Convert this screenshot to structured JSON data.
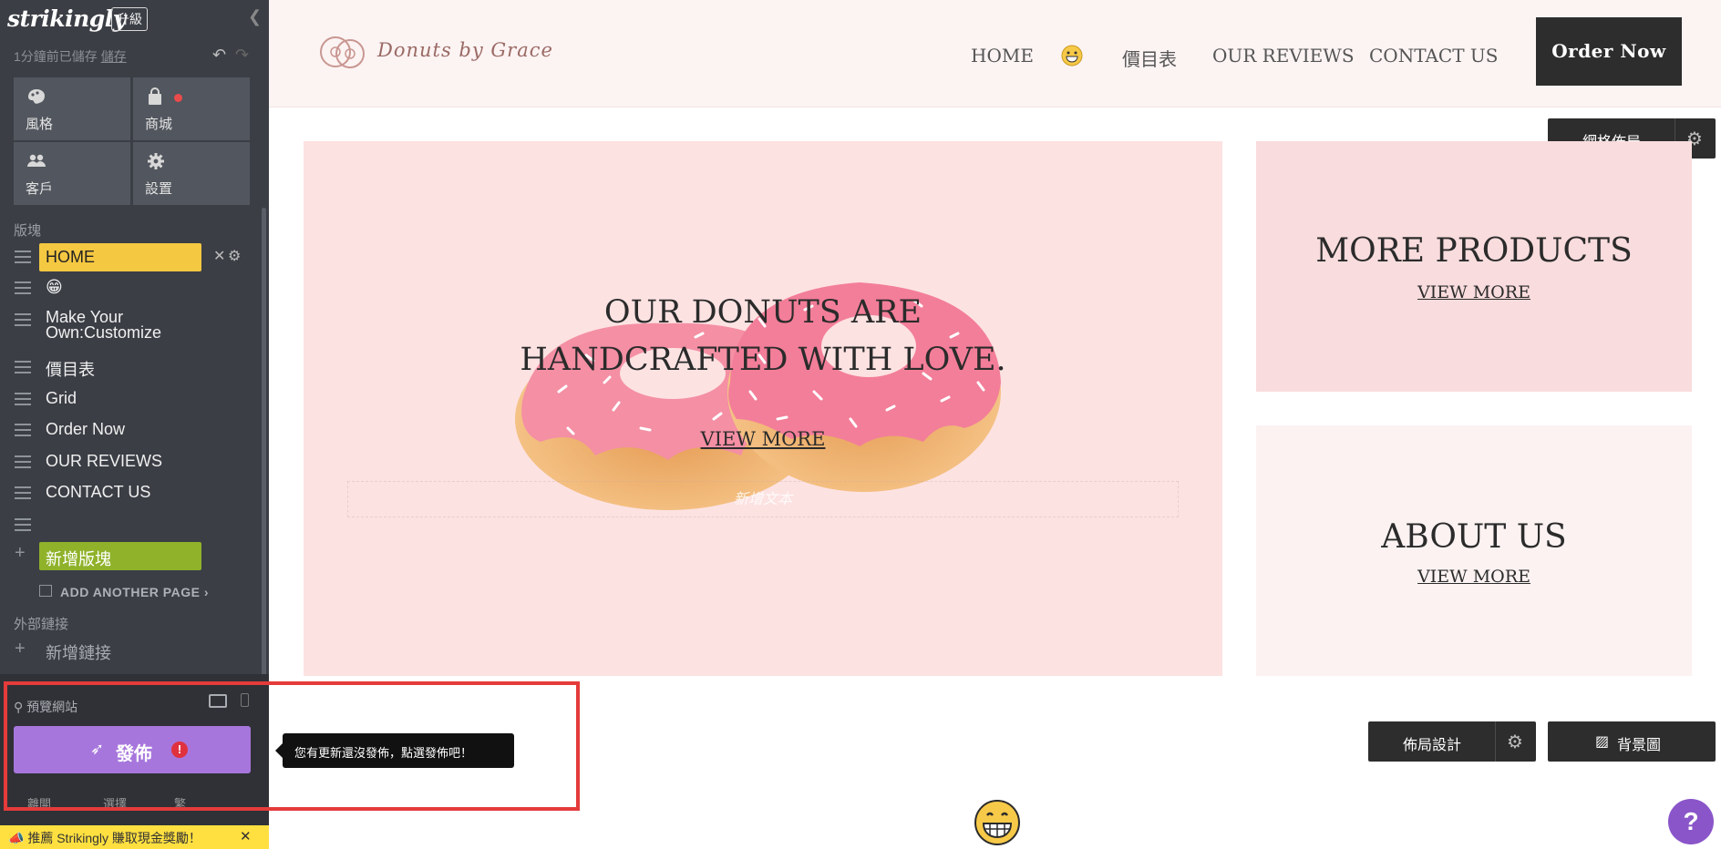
{
  "sidebar": {
    "logo": "strikingly",
    "upgrade_label": "升級",
    "saved_text": "1分鐘前已儲存",
    "save_link": "儲存",
    "tiles": [
      {
        "label": "風格",
        "icon": "palette-icon"
      },
      {
        "label": "商城",
        "icon": "shopping-bag-icon"
      },
      {
        "label": "客戶",
        "icon": "users-icon"
      },
      {
        "label": "設置",
        "icon": "gear-icon"
      }
    ],
    "sections_label": "版塊",
    "sections": [
      {
        "label": "HOME"
      },
      {
        "label": "😁"
      },
      {
        "label": "Make Your Own:Customize"
      },
      {
        "label": "價目表"
      },
      {
        "label": "Grid"
      },
      {
        "label": "Order Now"
      },
      {
        "label": "OUR REVIEWS"
      },
      {
        "label": "CONTACT US"
      },
      {
        "label": ""
      }
    ],
    "add_section": "新增版塊",
    "add_page": "ADD ANOTHER PAGE ›",
    "external_label": "外部鏈接",
    "add_external": "新增鏈接",
    "preview": "預覽網站",
    "publish": "發佈",
    "publish_warning": "!",
    "mini_tabs": [
      "離開",
      "選擇",
      "繁"
    ],
    "referral": "推薦 Strikingly 賺取現金獎勵！",
    "tooltip": "您有更新還沒發佈，點選發佈吧！"
  },
  "site": {
    "brand": "Donuts by Grace",
    "nav": [
      "HOME",
      "價目表",
      "OUR REVIEWS",
      "CONTACT US"
    ],
    "order_button": "Order Now",
    "grid_layout_button": "網格佈局",
    "hero": {
      "title_line1": "OUR DONUTS ARE",
      "title_line2": "HANDCRAFTED WITH LOVE.",
      "link": "VIEW MORE",
      "placeholder": "新增文本"
    },
    "cards": [
      {
        "title": "MORE PRODUCTS",
        "link": "VIEW MORE",
        "bg": "#f9dcdd"
      },
      {
        "title": "ABOUT US",
        "link": "VIEW MORE",
        "bg": "#fcf2f2"
      }
    ],
    "layout_design_button": "佈局設計",
    "background_button": "背景圖",
    "help": "?"
  },
  "colors": {
    "sidebar_bg": "#3b3e45",
    "home_highlight": "#f5c842",
    "add_section_bg": "#8fb22a",
    "publish_bg": "#a776dc",
    "header_bg": "#fcf3f3",
    "hero_bg": "#fde2e2",
    "highlight_frame": "#e53b3b"
  }
}
